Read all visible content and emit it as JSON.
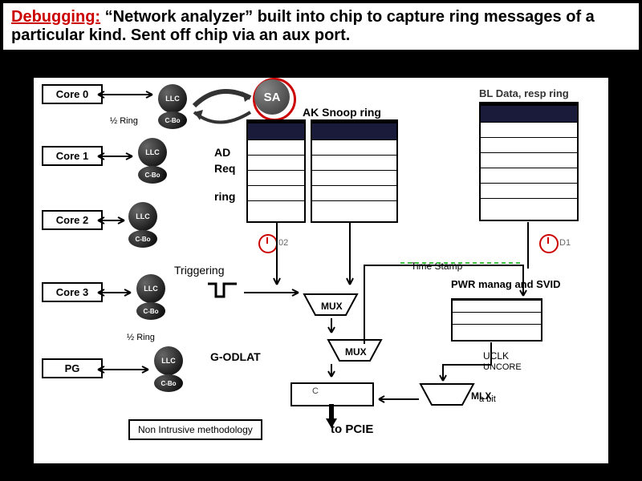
{
  "header": {
    "title": "Debugging:",
    "rest": " “Network analyzer” built into chip to capture ring messages of a particular kind.  Sent off chip via an aux port."
  },
  "cores": {
    "core0": "Core 0",
    "core1": "Core 1",
    "core2": "Core 2",
    "core3": "Core 3",
    "pg": "PG"
  },
  "nodes": {
    "llc": "LLC",
    "cbo": "C-Bo",
    "sa": "SA"
  },
  "labels": {
    "ring1": "½ Ring",
    "ring2": "½ Ring",
    "ad": "AD",
    "req": "Req",
    "ring": "ring",
    "aksnoop": "AK Snoop ring",
    "bldata": "BL Data, resp ring",
    "triggering": "Triggering",
    "timestamp": "Time Stamp",
    "pwr": "PWR manag and SVID",
    "godlat": "G-ODLAT",
    "mux": "MUX",
    "mlx": "MLX",
    "uclk": "UCLK",
    "uncore": "UNCORE",
    "abit": "a bit",
    "topcie": "to PCIE",
    "nonintr": "Non Intrusive methodology",
    "o2": "02",
    "d1": "D1",
    "cursor": "C"
  }
}
